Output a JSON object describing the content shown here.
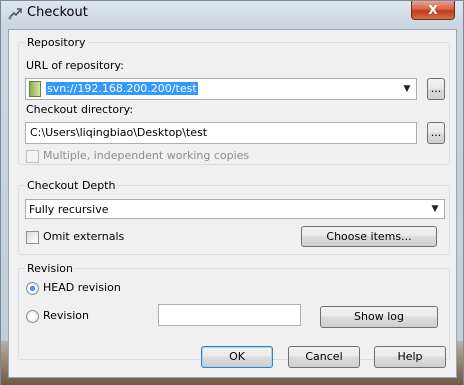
{
  "window": {
    "title": "Checkout",
    "close_label": "X"
  },
  "repository": {
    "group_label": "Repository",
    "url_label": "URL of repository:",
    "url_value": "svn://192.168.200.200/test",
    "url_browse": "...",
    "dir_label": "Checkout directory:",
    "dir_value": "C:\\Users\\liqingbiao\\Desktop\\test",
    "dir_browse": "...",
    "multiple_label": "Multiple, independent working copies",
    "multiple_checked": false
  },
  "depth": {
    "group_label": "Checkout Depth",
    "selected": "Fully recursive",
    "omit_externals_label": "Omit externals",
    "omit_externals_checked": false,
    "choose_items_label": "Choose items..."
  },
  "revision": {
    "group_label": "Revision",
    "head_label": "HEAD revision",
    "revision_label": "Revision",
    "revision_value": "",
    "show_log_label": "Show log",
    "selected": "HEAD revision"
  },
  "buttons": {
    "ok": "OK",
    "cancel": "Cancel",
    "help": "Help"
  },
  "colors": {
    "selection": "#3399ff",
    "close_button": "#c2391c",
    "dialog_bg": "#f0f0f0"
  },
  "icons": [
    "checkout-icon",
    "close-icon",
    "repository-icon",
    "dropdown-arrow-icon"
  ]
}
